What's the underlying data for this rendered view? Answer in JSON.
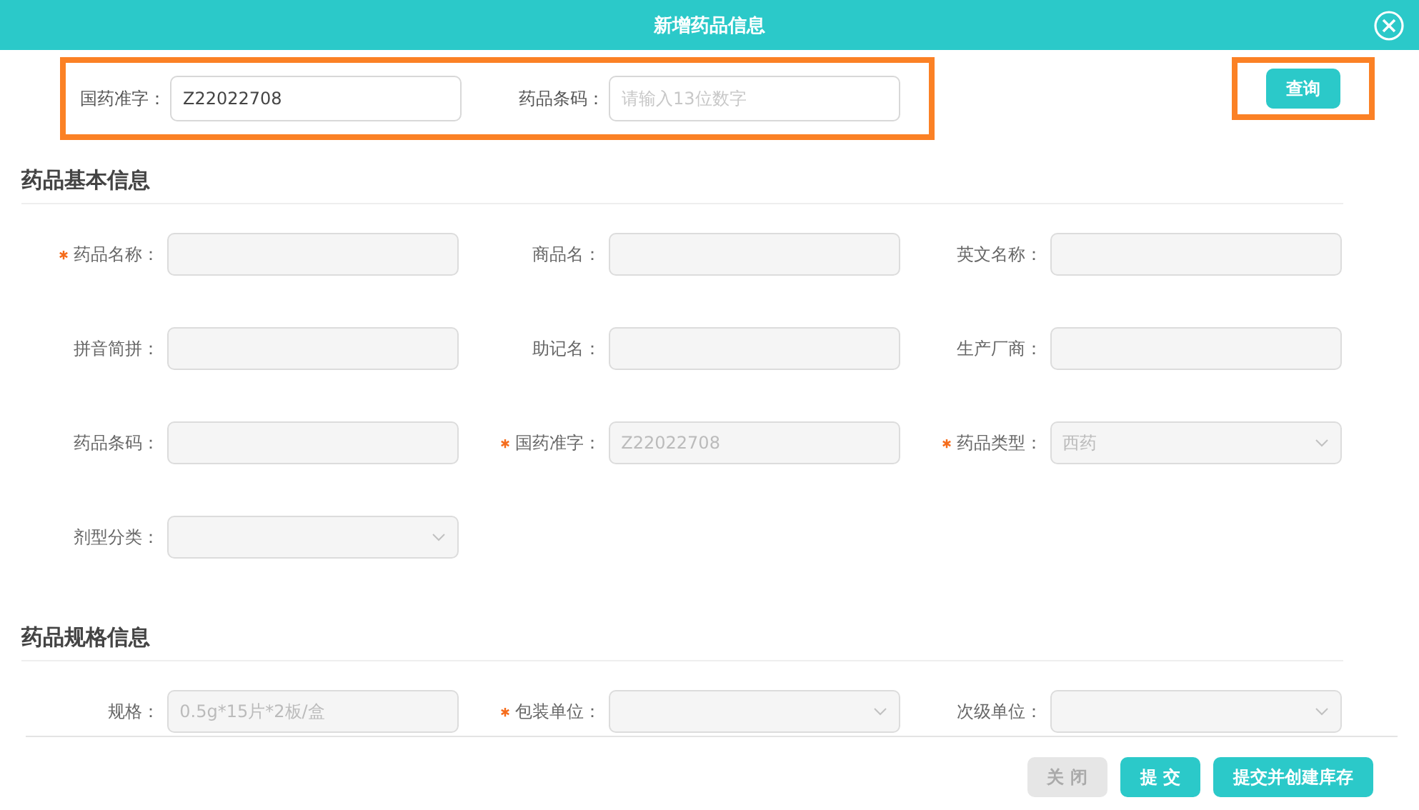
{
  "dialog": {
    "title": "新增药品信息"
  },
  "query": {
    "fields": [
      {
        "label": "国药准字：",
        "value": "Z22022708"
      },
      {
        "label": "药品条码：",
        "placeholder": "请输入13位数字"
      }
    ],
    "button": "查询"
  },
  "sections": [
    {
      "title": "药品基本信息",
      "fields": [
        {
          "label": "药品名称：",
          "required": true,
          "kind": "input"
        },
        {
          "label": "商品名：",
          "required": false,
          "kind": "input"
        },
        {
          "label": "英文名称：",
          "required": false,
          "kind": "input"
        },
        {
          "label": "拼音简拼：",
          "required": false,
          "kind": "input"
        },
        {
          "label": "助记名：",
          "required": false,
          "kind": "input"
        },
        {
          "label": "生产厂商：",
          "required": false,
          "kind": "input"
        },
        {
          "label": "药品条码：",
          "required": false,
          "kind": "input"
        },
        {
          "label": "国药准字：",
          "required": true,
          "kind": "input",
          "value": "Z22022708"
        },
        {
          "label": "药品类型：",
          "required": true,
          "kind": "select",
          "value": "西药"
        },
        {
          "label": "剂型分类：",
          "required": false,
          "kind": "select"
        }
      ]
    },
    {
      "title": "药品规格信息",
      "fields": [
        {
          "label": "规格：",
          "required": false,
          "kind": "input",
          "value": "0.5g*15片*2板/盒"
        },
        {
          "label": "包装单位：",
          "required": true,
          "kind": "select"
        },
        {
          "label": "次级单位：",
          "required": false,
          "kind": "select"
        }
      ]
    }
  ],
  "footer": {
    "buttons": [
      {
        "label": "关 闭",
        "disabled": true
      },
      {
        "label": "提 交",
        "disabled": false
      },
      {
        "label": "提交并创建库存",
        "disabled": false
      }
    ]
  }
}
